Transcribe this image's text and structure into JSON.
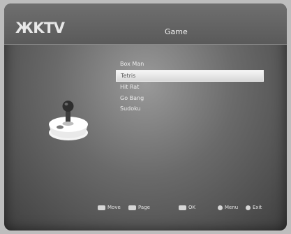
{
  "header": {
    "logo": "ЖKTV",
    "title": "Game"
  },
  "menu": {
    "items": [
      "Box Man",
      "Tetris",
      "Hit Rat",
      "Go Bang",
      "Sudoku"
    ],
    "selected_index": 1
  },
  "footer": {
    "move_label": "Move",
    "page_label": "Page",
    "ok_label": "OK",
    "menu_label": "Menu",
    "exit_label": "Exit"
  }
}
